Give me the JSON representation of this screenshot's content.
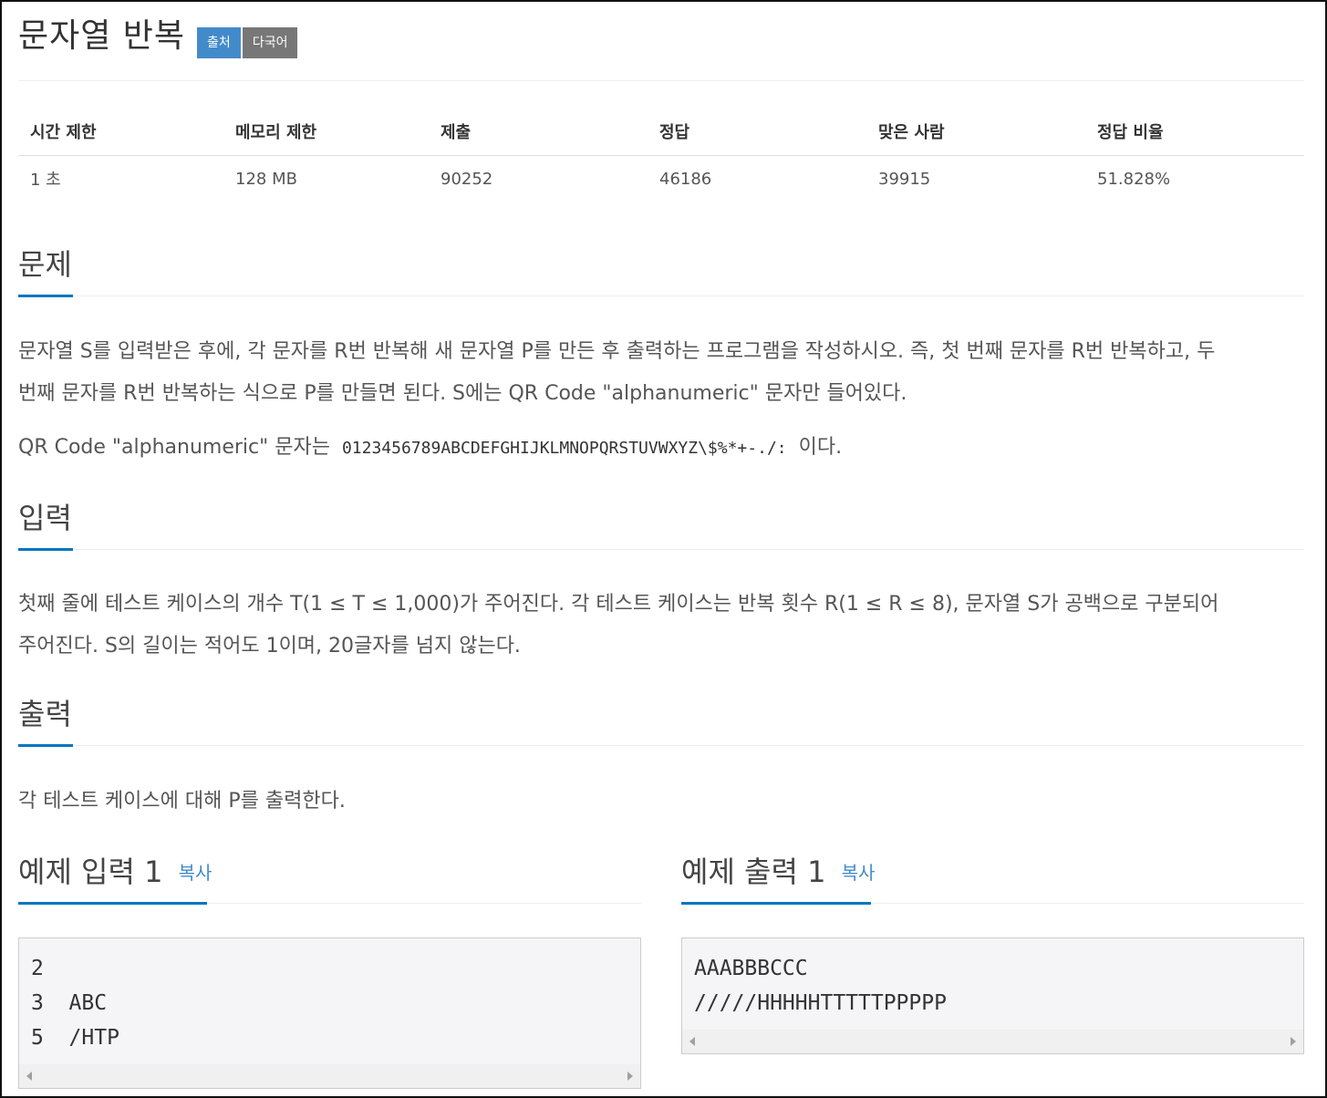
{
  "problem": {
    "title": "문자열 반복",
    "labels": {
      "source": "출처",
      "multilang": "다국어"
    }
  },
  "info_table": {
    "headers": [
      "시간 제한",
      "메모리 제한",
      "제출",
      "정답",
      "맞은 사람",
      "정답 비율"
    ],
    "values": [
      "1 초",
      "128 MB",
      "90252",
      "46186",
      "39915",
      "51.828%"
    ]
  },
  "sections": {
    "description": {
      "heading": "문제",
      "para1_line1": "문자열 S를 입력받은 후에, 각 문자를 R번 반복해 새 문자열 P를 만든 후 출력하는 프로그램을 작성하시오. 즉, 첫 번째 문자를 R번 반복하고, 두",
      "para1_line2": "번째 문자를 R번 반복하는 식으로 P를 만들면 된다. S에는 QR Code \"alphanumeric\" 문자만 들어있다.",
      "para2_prefix": "QR Code \"alphanumeric\" 문자는",
      "para2_code": "0123456789ABCDEFGHIJKLMNOPQRSTUVWXYZ\\$%*+-./:",
      "para2_suffix": "이다."
    },
    "input": {
      "heading": "입력",
      "line1": "첫째 줄에 테스트 케이스의 개수 T(1 ≤ T ≤ 1,000)가 주어진다. 각 테스트 케이스는 반복 횟수 R(1 ≤ R ≤ 8), 문자열 S가 공백으로 구분되어",
      "line2": "주어진다. S의 길이는 적어도 1이며, 20글자를 넘지 않는다."
    },
    "output": {
      "heading": "출력",
      "line1": "각 테스트 케이스에 대해 P를 출력한다."
    }
  },
  "samples": {
    "input": {
      "heading": "예제 입력 1",
      "copy_label": "복사",
      "lines": [
        "2",
        "3  ABC",
        "5  /HTP"
      ]
    },
    "output": {
      "heading": "예제 출력 1",
      "copy_label": "복사",
      "lines": [
        "AAABBBCCC",
        "/////HHHHHTTTTTPPPPP"
      ]
    }
  },
  "colors": {
    "accent": "#0076c0",
    "label_blue": "#428bca",
    "label_gray": "#777777"
  }
}
